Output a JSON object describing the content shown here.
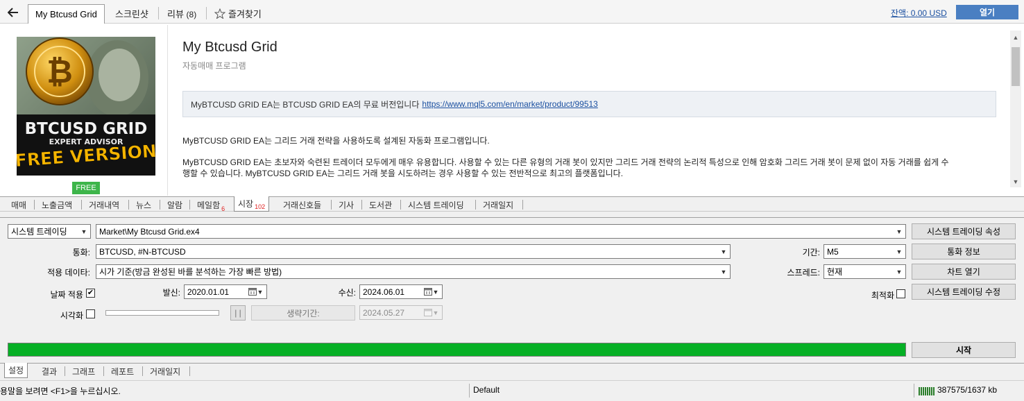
{
  "header": {
    "back_icon": "arrow-left-icon",
    "active_tab": "My Btcusd Grid",
    "tabs": [
      "스크린샷",
      "리뷰",
      "즐겨찾기"
    ],
    "review_count": "(8)",
    "balance": "잔액: 0.00 USD",
    "open_button": "열기"
  },
  "product": {
    "image_lines": [
      "BTCUSD GRID",
      "EXPERT ADVISOR",
      "FREE VERSION"
    ],
    "badge": "FREE",
    "title": "My Btcusd Grid",
    "subtitle": "자동매매 프로그램",
    "notice_text": "MyBTCUSD GRID EA는 BTCUSD GRID EA의 무료 버전입니다",
    "notice_link": "https://www.mql5.com/en/market/product/99513",
    "para1": "MyBTCUSD GRID EA는 그리드 거래 전략을 사용하도록 설계된 자동화 프로그램입니다.",
    "para2_line1": "MyBTCUSD GRID EA는 초보자와 숙련된 트레이더 모두에게 매우 유용합니다. 사용할 수 있는 다른 유형의 거래 봇이 있지만 그리드 거래 전략의 논리적 특성으로 인해 암호화 그리드 거래 봇이 문제 없이 자동 거래를 쉽게 수",
    "para2_line2": "행할 수 있습니다. MyBTCUSD GRID EA는 그리드 거래 봇을 시도하려는 경우 사용할 수 있는 전반적으로 최고의 플랫폼입니다."
  },
  "terminal_tabs": {
    "items": [
      "매매",
      "노출금액",
      "거래내역",
      "뉴스",
      "알람",
      "메일함",
      "시장",
      "거래신호들",
      "기사",
      "도서관",
      "시스템 트레이딩",
      "거래일지"
    ],
    "mail_count": "6",
    "market_count": "102"
  },
  "tester": {
    "mode": "시스템 트레이딩",
    "expert": "Market\\My Btcusd Grid.ex4",
    "expert_props_button": "시스템 트레이딩 속성",
    "symbol_label": "통화:",
    "symbol": "BTCUSD, #N-BTCUSD",
    "period_label": "기간:",
    "period": "M5",
    "symbol_props_button": "통화 정보",
    "model_label": "적용 데이타:",
    "model": "시가 기준(방금 완성된 바를 분석하는 가장 빠른 방법)",
    "spread_label": "스프레드:",
    "spread": "현재",
    "open_chart_button": "차트 열기",
    "use_date_label": "날짜 적용",
    "use_date_checked": "✔",
    "from_label": "발신:",
    "from_date": "2020.01.01",
    "to_label": "수신:",
    "to_date": "2024.06.01",
    "optimization_label": "최적화",
    "modify_expert_button": "시스템 트레이딩 수정",
    "visual_label": "시각화",
    "pause_button": "| |",
    "skip_button": "생략기간:",
    "skip_date": "2024.05.27",
    "progress": 1.0,
    "start_button": "시작"
  },
  "bottom_tabs": [
    "설정",
    "결과",
    "그래프",
    "레포트",
    "거래일지"
  ],
  "status": {
    "help": "용말을 보려면 <F1>을 누르십시오.",
    "profile": "Default",
    "traffic": "387575/1637 kb"
  },
  "colors": {
    "progress_green": "#06b025",
    "open_button": "#4a7fc2",
    "free_badge": "#3db54a",
    "link": "#1a4fa0"
  }
}
